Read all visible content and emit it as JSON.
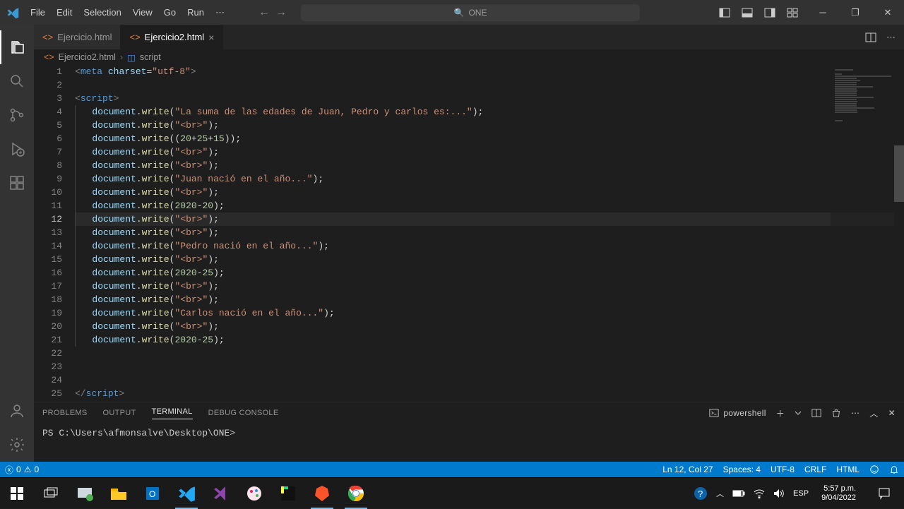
{
  "menu": [
    "File",
    "Edit",
    "Selection",
    "View",
    "Go",
    "Run"
  ],
  "search_label": "ONE",
  "tabs": [
    {
      "name": "Ejercicio.html",
      "active": false
    },
    {
      "name": "Ejercicio2.html",
      "active": true
    }
  ],
  "breadcrumb": {
    "file": "Ejercicio2.html",
    "symbol": "script"
  },
  "code_lines": [
    [
      {
        "t": "brk",
        "v": "<"
      },
      {
        "t": "tag",
        "v": "meta"
      },
      {
        "t": "punc",
        "v": " "
      },
      {
        "t": "attr",
        "v": "charset"
      },
      {
        "t": "punc",
        "v": "="
      },
      {
        "t": "str",
        "v": "\"utf-8\""
      },
      {
        "t": "brk",
        "v": ">"
      }
    ],
    [],
    [
      {
        "t": "brk",
        "v": "<"
      },
      {
        "t": "tag",
        "v": "script"
      },
      {
        "t": "brk",
        "v": ">"
      }
    ],
    [
      {
        "t": "indent"
      },
      {
        "t": "obj",
        "v": "document"
      },
      {
        "t": "punc",
        "v": "."
      },
      {
        "t": "fn",
        "v": "write"
      },
      {
        "t": "punc",
        "v": "("
      },
      {
        "t": "str",
        "v": "\"La suma de las edades de Juan, Pedro y carlos es:...\""
      },
      {
        "t": "punc",
        "v": ");"
      }
    ],
    [
      {
        "t": "indent"
      },
      {
        "t": "obj",
        "v": "document"
      },
      {
        "t": "punc",
        "v": "."
      },
      {
        "t": "fn",
        "v": "write"
      },
      {
        "t": "punc",
        "v": "("
      },
      {
        "t": "str",
        "v": "\"<br>\""
      },
      {
        "t": "punc",
        "v": ");"
      }
    ],
    [
      {
        "t": "indent"
      },
      {
        "t": "obj",
        "v": "document"
      },
      {
        "t": "punc",
        "v": "."
      },
      {
        "t": "fn",
        "v": "write"
      },
      {
        "t": "punc",
        "v": "(("
      },
      {
        "t": "num",
        "v": "20"
      },
      {
        "t": "punc",
        "v": "+"
      },
      {
        "t": "num",
        "v": "25"
      },
      {
        "t": "punc",
        "v": "+"
      },
      {
        "t": "num",
        "v": "15"
      },
      {
        "t": "punc",
        "v": "));"
      }
    ],
    [
      {
        "t": "indent"
      },
      {
        "t": "obj",
        "v": "document"
      },
      {
        "t": "punc",
        "v": "."
      },
      {
        "t": "fn",
        "v": "write"
      },
      {
        "t": "punc",
        "v": "("
      },
      {
        "t": "str",
        "v": "\"<br>\""
      },
      {
        "t": "punc",
        "v": ");"
      }
    ],
    [
      {
        "t": "indent"
      },
      {
        "t": "obj",
        "v": "document"
      },
      {
        "t": "punc",
        "v": "."
      },
      {
        "t": "fn",
        "v": "write"
      },
      {
        "t": "punc",
        "v": "("
      },
      {
        "t": "str",
        "v": "\"<br>\""
      },
      {
        "t": "punc",
        "v": ");"
      }
    ],
    [
      {
        "t": "indent"
      },
      {
        "t": "obj",
        "v": "document"
      },
      {
        "t": "punc",
        "v": "."
      },
      {
        "t": "fn",
        "v": "write"
      },
      {
        "t": "punc",
        "v": "("
      },
      {
        "t": "str",
        "v": "\"Juan nació en el año...\""
      },
      {
        "t": "punc",
        "v": ");"
      }
    ],
    [
      {
        "t": "indent"
      },
      {
        "t": "obj",
        "v": "document"
      },
      {
        "t": "punc",
        "v": "."
      },
      {
        "t": "fn",
        "v": "write"
      },
      {
        "t": "punc",
        "v": "("
      },
      {
        "t": "str",
        "v": "\"<br>\""
      },
      {
        "t": "punc",
        "v": ");"
      }
    ],
    [
      {
        "t": "indent"
      },
      {
        "t": "obj",
        "v": "document"
      },
      {
        "t": "punc",
        "v": "."
      },
      {
        "t": "fn",
        "v": "write"
      },
      {
        "t": "punc",
        "v": "("
      },
      {
        "t": "num",
        "v": "2020"
      },
      {
        "t": "punc",
        "v": "-"
      },
      {
        "t": "num",
        "v": "20"
      },
      {
        "t": "punc",
        "v": ");"
      }
    ],
    [
      {
        "t": "indent"
      },
      {
        "t": "obj",
        "v": "document"
      },
      {
        "t": "punc",
        "v": "."
      },
      {
        "t": "fn",
        "v": "write"
      },
      {
        "t": "punc",
        "v": "("
      },
      {
        "t": "str",
        "v": "\"<br>\""
      },
      {
        "t": "punc",
        "v": ");"
      }
    ],
    [
      {
        "t": "indent"
      },
      {
        "t": "obj",
        "v": "document"
      },
      {
        "t": "punc",
        "v": "."
      },
      {
        "t": "fn",
        "v": "write"
      },
      {
        "t": "punc",
        "v": "("
      },
      {
        "t": "str",
        "v": "\"<br>\""
      },
      {
        "t": "punc",
        "v": ");"
      }
    ],
    [
      {
        "t": "indent"
      },
      {
        "t": "obj",
        "v": "document"
      },
      {
        "t": "punc",
        "v": "."
      },
      {
        "t": "fn",
        "v": "write"
      },
      {
        "t": "punc",
        "v": "("
      },
      {
        "t": "str",
        "v": "\"Pedro nació en el año...\""
      },
      {
        "t": "punc",
        "v": ");"
      }
    ],
    [
      {
        "t": "indent"
      },
      {
        "t": "obj",
        "v": "document"
      },
      {
        "t": "punc",
        "v": "."
      },
      {
        "t": "fn",
        "v": "write"
      },
      {
        "t": "punc",
        "v": "("
      },
      {
        "t": "str",
        "v": "\"<br>\""
      },
      {
        "t": "punc",
        "v": ");"
      }
    ],
    [
      {
        "t": "indent"
      },
      {
        "t": "obj",
        "v": "document"
      },
      {
        "t": "punc",
        "v": "."
      },
      {
        "t": "fn",
        "v": "write"
      },
      {
        "t": "punc",
        "v": "("
      },
      {
        "t": "num",
        "v": "2020"
      },
      {
        "t": "punc",
        "v": "-"
      },
      {
        "t": "num",
        "v": "25"
      },
      {
        "t": "punc",
        "v": ");"
      }
    ],
    [
      {
        "t": "indent"
      },
      {
        "t": "obj",
        "v": "document"
      },
      {
        "t": "punc",
        "v": "."
      },
      {
        "t": "fn",
        "v": "write"
      },
      {
        "t": "punc",
        "v": "("
      },
      {
        "t": "str",
        "v": "\"<br>\""
      },
      {
        "t": "punc",
        "v": ");"
      }
    ],
    [
      {
        "t": "indent"
      },
      {
        "t": "obj",
        "v": "document"
      },
      {
        "t": "punc",
        "v": "."
      },
      {
        "t": "fn",
        "v": "write"
      },
      {
        "t": "punc",
        "v": "("
      },
      {
        "t": "str",
        "v": "\"<br>\""
      },
      {
        "t": "punc",
        "v": ");"
      }
    ],
    [
      {
        "t": "indent"
      },
      {
        "t": "obj",
        "v": "document"
      },
      {
        "t": "punc",
        "v": "."
      },
      {
        "t": "fn",
        "v": "write"
      },
      {
        "t": "punc",
        "v": "("
      },
      {
        "t": "str",
        "v": "\"Carlos nació en el año...\""
      },
      {
        "t": "punc",
        "v": ");"
      }
    ],
    [
      {
        "t": "indent"
      },
      {
        "t": "obj",
        "v": "document"
      },
      {
        "t": "punc",
        "v": "."
      },
      {
        "t": "fn",
        "v": "write"
      },
      {
        "t": "punc",
        "v": "("
      },
      {
        "t": "str",
        "v": "\"<br>\""
      },
      {
        "t": "punc",
        "v": ");"
      }
    ],
    [
      {
        "t": "indent"
      },
      {
        "t": "obj",
        "v": "document"
      },
      {
        "t": "punc",
        "v": "."
      },
      {
        "t": "fn",
        "v": "write"
      },
      {
        "t": "punc",
        "v": "("
      },
      {
        "t": "num",
        "v": "2020"
      },
      {
        "t": "punc",
        "v": "-"
      },
      {
        "t": "num",
        "v": "25"
      },
      {
        "t": "punc",
        "v": ");"
      }
    ],
    [],
    [],
    [],
    [
      {
        "t": "brk",
        "v": "</"
      },
      {
        "t": "tag",
        "v": "script"
      },
      {
        "t": "brk",
        "v": ">"
      }
    ]
  ],
  "current_line": 12,
  "panel_tabs": [
    "PROBLEMS",
    "OUTPUT",
    "TERMINAL",
    "DEBUG CONSOLE"
  ],
  "panel_active": "TERMINAL",
  "shell_name": "powershell",
  "terminal_prompt": "PS C:\\Users\\afmonsalve\\Desktop\\ONE>",
  "status": {
    "errors": "0",
    "warnings": "0",
    "pos": "Ln 12, Col 27",
    "spaces": "Spaces: 4",
    "encoding": "UTF-8",
    "eol": "CRLF",
    "lang": "HTML"
  },
  "taskbar": {
    "lang": "ESP",
    "time": "5:57 p.m.",
    "date": "9/04/2022"
  }
}
